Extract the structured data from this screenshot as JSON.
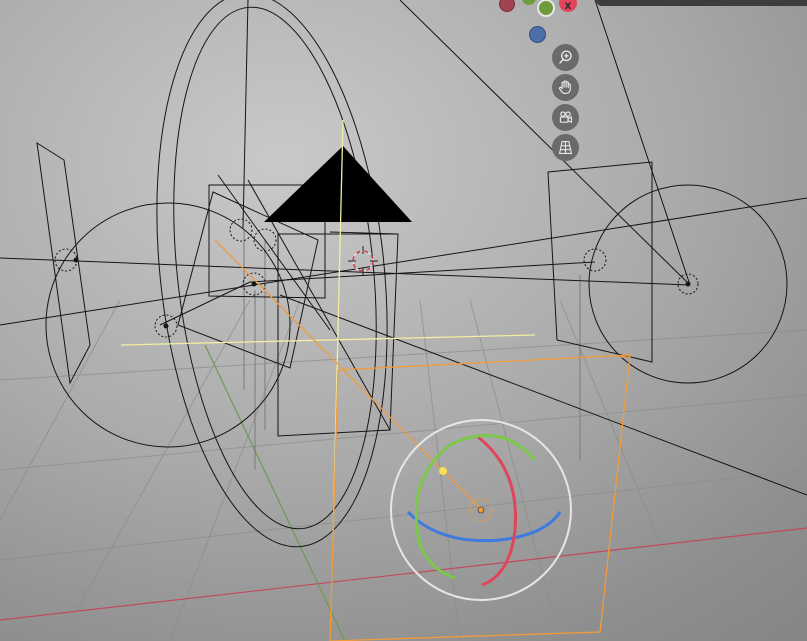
{
  "viewport": {
    "background_top": "#c9c9c9",
    "background_bottom": "#7f7f7f"
  },
  "axis_gizmo": {
    "x_axis_label": "X",
    "x_color": "#e0455a",
    "y_color": "#7fb33a",
    "z_color": "#4b6fa8",
    "neg_x_color": "#9a3d48"
  },
  "nav_buttons": [
    {
      "name": "zoom-button",
      "icon": "magnifier-plus-icon"
    },
    {
      "name": "pan-button",
      "icon": "hand-icon"
    },
    {
      "name": "camera-view-button",
      "icon": "camera-icon"
    },
    {
      "name": "perspective-toggle-button",
      "icon": "grid-perspective-icon"
    }
  ],
  "colors": {
    "wire": "#141414",
    "selected_active": "#f29b3a",
    "light_yellow": "#f5f0a0",
    "grid_line": "#8a8a8a",
    "axis_x_red": "#c0485a",
    "axis_y_green": "#6a9a4a",
    "rotate_x": "#e0455a",
    "rotate_y": "#7cc84a",
    "rotate_z": "#3f7ae0",
    "rotate_outer": "#e8e8e8"
  }
}
